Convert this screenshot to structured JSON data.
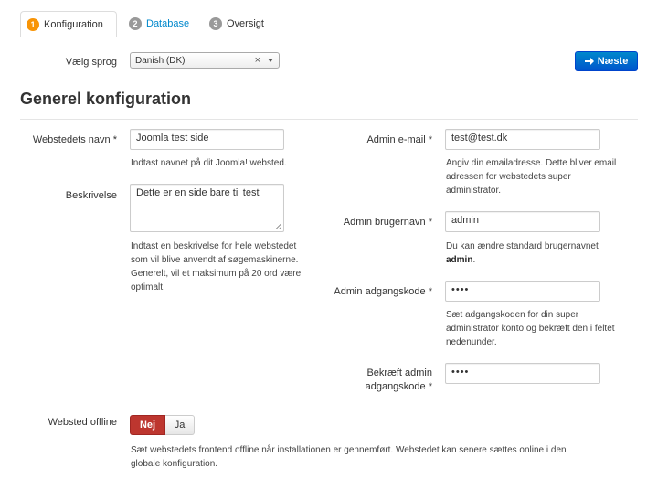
{
  "tabs": [
    {
      "number": "1",
      "label": "Konfiguration",
      "state": "active",
      "color": "#f89406"
    },
    {
      "number": "2",
      "label": "Database",
      "state": "link",
      "color": "#999999"
    },
    {
      "number": "3",
      "label": "Oversigt",
      "state": "plain",
      "color": "#999999"
    }
  ],
  "language": {
    "label": "Vælg sprog",
    "selected": "Danish (DK)",
    "clear_glyph": "×"
  },
  "next_button": {
    "label": "Næste",
    "icon": "arrow-right-icon"
  },
  "section_title": "Generel konfiguration",
  "left": {
    "site_name": {
      "label": "Webstedets navn *",
      "value": "Joomla test side",
      "help": "Indtast navnet på dit Joomla! websted."
    },
    "description": {
      "label": "Beskrivelse",
      "value": "Dette er en side bare til test",
      "help_lines": [
        "Indtast en beskrivelse for hele webstedet",
        "som vil blive anvendt af søgemaskinerne.",
        "Generelt, vil et maksimum på 20 ord være",
        "optimalt."
      ]
    }
  },
  "right": {
    "admin_email": {
      "label": "Admin e-mail *",
      "value": "test@test.dk",
      "help_lines": [
        "Angiv din emailadresse. Dette bliver email",
        "adressen for webstedets super",
        "administrator."
      ]
    },
    "admin_username": {
      "label": "Admin brugernavn *",
      "value": "admin",
      "help_line1": "Du kan ændre standard brugernavnet",
      "help_bold": "admin",
      "help_end": "."
    },
    "admin_password": {
      "label": "Admin adgangskode *",
      "value": "••••",
      "help_lines": [
        "Sæt adgangskoden for din super",
        "administrator konto og bekræft den i feltet",
        "nedenunder."
      ]
    },
    "confirm_password": {
      "label_line1": "Bekræft admin",
      "label_line2": "adgangskode *",
      "value": "••••"
    }
  },
  "offline": {
    "label": "Websted offline",
    "options": [
      "Nej",
      "Ja"
    ],
    "selected": "Nej",
    "help_lines": [
      "Sæt webstedets frontend offline når installationen er gennemført. Webstedet kan senere sættes online i den",
      "globale konfiguration."
    ]
  },
  "colors": {
    "accent": "#0088cc",
    "danger": "#bd362f"
  }
}
